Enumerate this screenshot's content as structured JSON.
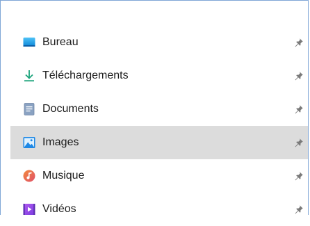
{
  "quick_access": {
    "items": [
      {
        "label": "Bureau",
        "icon": "desktop-icon",
        "pinned": true,
        "selected": false
      },
      {
        "label": "Téléchargements",
        "icon": "download-icon",
        "pinned": true,
        "selected": false
      },
      {
        "label": "Documents",
        "icon": "document-icon",
        "pinned": true,
        "selected": false
      },
      {
        "label": "Images",
        "icon": "pictures-icon",
        "pinned": true,
        "selected": true
      },
      {
        "label": "Musique",
        "icon": "music-icon",
        "pinned": true,
        "selected": false
      },
      {
        "label": "Vidéos",
        "icon": "videos-icon",
        "pinned": true,
        "selected": false
      }
    ]
  },
  "colors": {
    "selected_background": "#dcdcdc",
    "frame_border": "#7fa6d6",
    "pin": "#7a7a7a"
  }
}
